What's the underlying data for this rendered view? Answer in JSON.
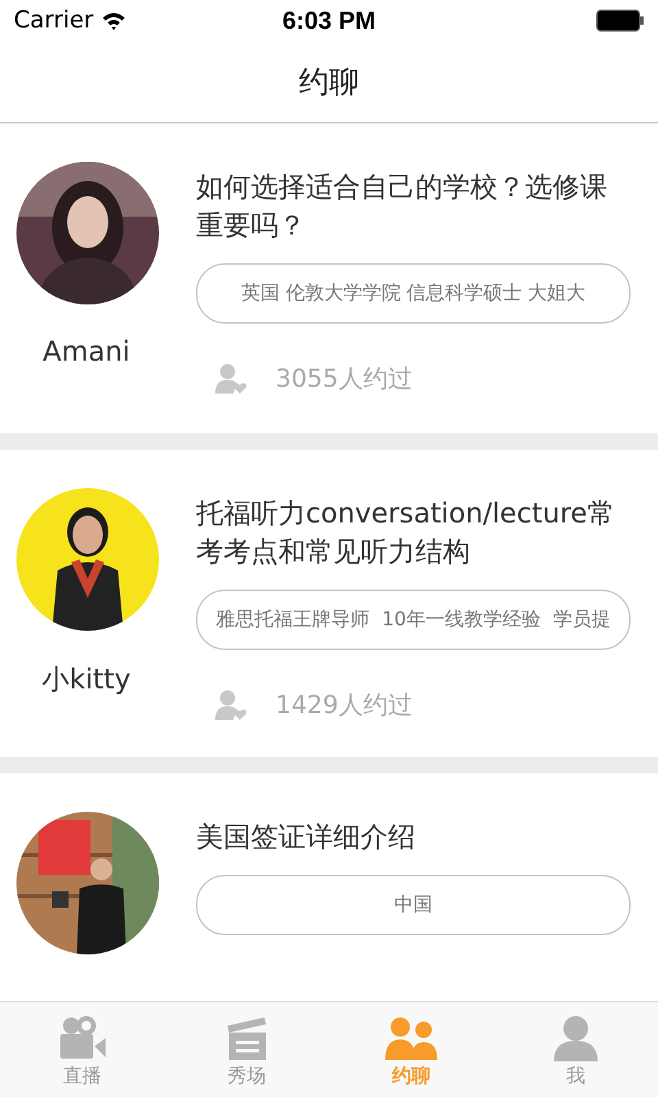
{
  "status_bar": {
    "carrier": "Carrier",
    "time": "6:03 PM"
  },
  "nav": {
    "title": "约聊"
  },
  "cards": [
    {
      "name": "Amani",
      "title": "如何选择适合自己的学校？选修课重要吗？",
      "tag": "英国 伦敦大学学院 信息科学硕士 大姐大",
      "count": "3055人约过"
    },
    {
      "name": "小kitty",
      "title": "托福听力conversation/lecture常考考点和常见听力结构",
      "tag": "雅思托福王牌导师  10年一线教学经验  学员提",
      "count": "1429人约过"
    },
    {
      "title": "美国签证详细介绍",
      "tag": "中国"
    }
  ],
  "tabs": [
    {
      "label": "直播",
      "selected": false
    },
    {
      "label": "秀场",
      "selected": false
    },
    {
      "label": "约聊",
      "selected": true
    },
    {
      "label": "我",
      "selected": false
    }
  ]
}
